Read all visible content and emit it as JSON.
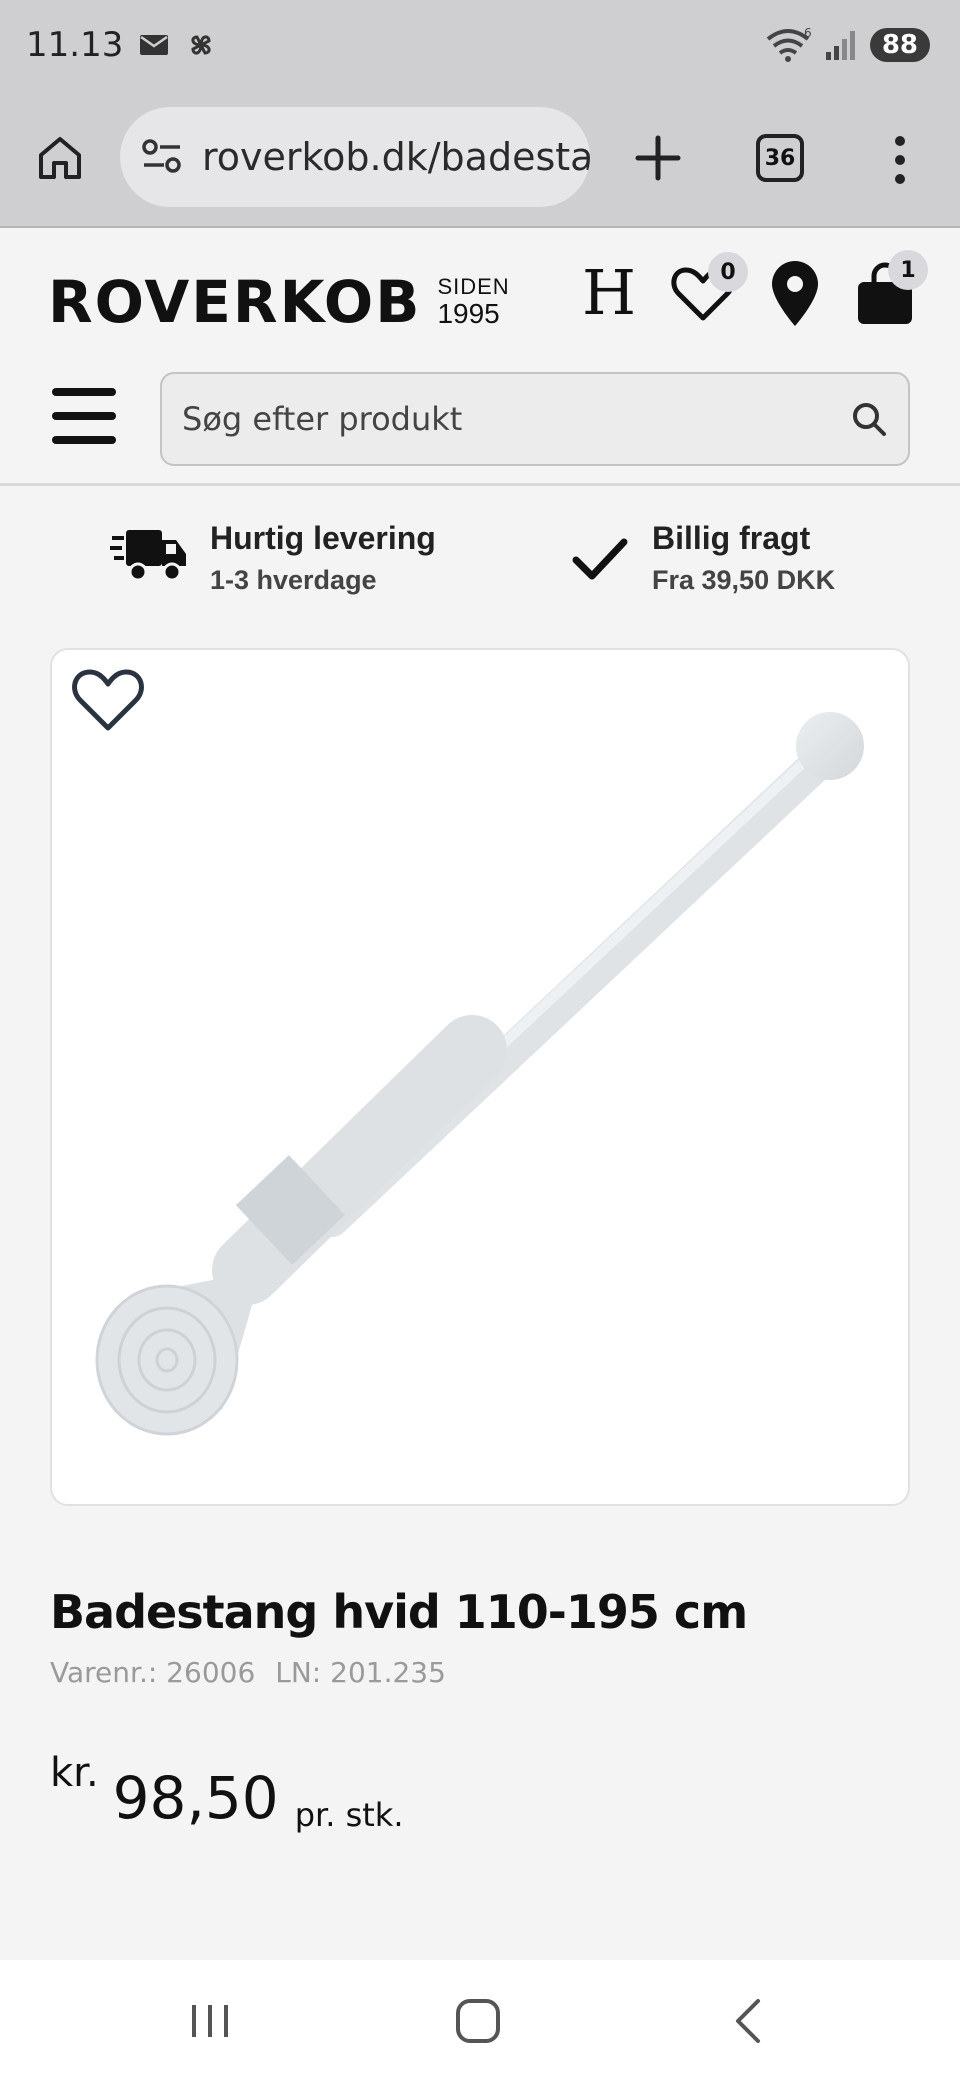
{
  "status_bar": {
    "time": "11.13",
    "battery": "88",
    "icons": [
      "mail-icon",
      "pinwheel-icon",
      "wifi-icon",
      "signal-icon"
    ],
    "wifi_label": "6"
  },
  "browser": {
    "url": "roverkob.dk/badesta",
    "tab_count": "36",
    "icons": [
      "home-icon",
      "site-settings-icon",
      "plus-icon",
      "tabs-icon",
      "more-icon"
    ]
  },
  "header": {
    "logo_text": "ROVERKOB",
    "since_label": "SIDEN",
    "since_year": "1995",
    "h_logo": "H",
    "wishlist_count": "0",
    "cart_count": "1"
  },
  "search": {
    "placeholder": "Søg efter produkt"
  },
  "usps": [
    {
      "title": "Hurtig levering",
      "subtitle": "1-3 hverdage",
      "icon": "delivery-truck-icon"
    },
    {
      "title": "Billig fragt",
      "subtitle": "Fra 39,50 DKK",
      "icon": "checkmark-icon"
    }
  ],
  "product": {
    "title": "Badestang hvid 110-195 cm",
    "sku": "Varenr.: 26006",
    "ln": "LN: 201.235",
    "currency": "kr.",
    "price": "98,50",
    "unit": "pr. stk."
  },
  "colors": {
    "accent": "#111111",
    "badge": "#d9d9dd",
    "browser_chrome": "#cfcfd1"
  }
}
